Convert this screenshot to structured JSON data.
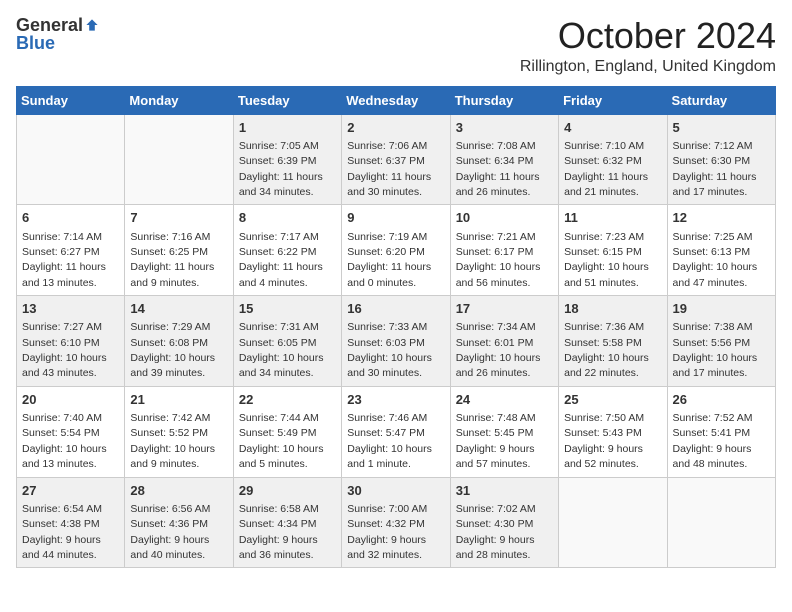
{
  "logo": {
    "general": "General",
    "blue": "Blue"
  },
  "title": "October 2024",
  "location": "Rillington, England, United Kingdom",
  "days_of_week": [
    "Sunday",
    "Monday",
    "Tuesday",
    "Wednesday",
    "Thursday",
    "Friday",
    "Saturday"
  ],
  "weeks": [
    [
      {
        "day": "",
        "info": ""
      },
      {
        "day": "",
        "info": ""
      },
      {
        "day": "1",
        "info": "Sunrise: 7:05 AM\nSunset: 6:39 PM\nDaylight: 11 hours and 34 minutes."
      },
      {
        "day": "2",
        "info": "Sunrise: 7:06 AM\nSunset: 6:37 PM\nDaylight: 11 hours and 30 minutes."
      },
      {
        "day": "3",
        "info": "Sunrise: 7:08 AM\nSunset: 6:34 PM\nDaylight: 11 hours and 26 minutes."
      },
      {
        "day": "4",
        "info": "Sunrise: 7:10 AM\nSunset: 6:32 PM\nDaylight: 11 hours and 21 minutes."
      },
      {
        "day": "5",
        "info": "Sunrise: 7:12 AM\nSunset: 6:30 PM\nDaylight: 11 hours and 17 minutes."
      }
    ],
    [
      {
        "day": "6",
        "info": "Sunrise: 7:14 AM\nSunset: 6:27 PM\nDaylight: 11 hours and 13 minutes."
      },
      {
        "day": "7",
        "info": "Sunrise: 7:16 AM\nSunset: 6:25 PM\nDaylight: 11 hours and 9 minutes."
      },
      {
        "day": "8",
        "info": "Sunrise: 7:17 AM\nSunset: 6:22 PM\nDaylight: 11 hours and 4 minutes."
      },
      {
        "day": "9",
        "info": "Sunrise: 7:19 AM\nSunset: 6:20 PM\nDaylight: 11 hours and 0 minutes."
      },
      {
        "day": "10",
        "info": "Sunrise: 7:21 AM\nSunset: 6:17 PM\nDaylight: 10 hours and 56 minutes."
      },
      {
        "day": "11",
        "info": "Sunrise: 7:23 AM\nSunset: 6:15 PM\nDaylight: 10 hours and 51 minutes."
      },
      {
        "day": "12",
        "info": "Sunrise: 7:25 AM\nSunset: 6:13 PM\nDaylight: 10 hours and 47 minutes."
      }
    ],
    [
      {
        "day": "13",
        "info": "Sunrise: 7:27 AM\nSunset: 6:10 PM\nDaylight: 10 hours and 43 minutes."
      },
      {
        "day": "14",
        "info": "Sunrise: 7:29 AM\nSunset: 6:08 PM\nDaylight: 10 hours and 39 minutes."
      },
      {
        "day": "15",
        "info": "Sunrise: 7:31 AM\nSunset: 6:05 PM\nDaylight: 10 hours and 34 minutes."
      },
      {
        "day": "16",
        "info": "Sunrise: 7:33 AM\nSunset: 6:03 PM\nDaylight: 10 hours and 30 minutes."
      },
      {
        "day": "17",
        "info": "Sunrise: 7:34 AM\nSunset: 6:01 PM\nDaylight: 10 hours and 26 minutes."
      },
      {
        "day": "18",
        "info": "Sunrise: 7:36 AM\nSunset: 5:58 PM\nDaylight: 10 hours and 22 minutes."
      },
      {
        "day": "19",
        "info": "Sunrise: 7:38 AM\nSunset: 5:56 PM\nDaylight: 10 hours and 17 minutes."
      }
    ],
    [
      {
        "day": "20",
        "info": "Sunrise: 7:40 AM\nSunset: 5:54 PM\nDaylight: 10 hours and 13 minutes."
      },
      {
        "day": "21",
        "info": "Sunrise: 7:42 AM\nSunset: 5:52 PM\nDaylight: 10 hours and 9 minutes."
      },
      {
        "day": "22",
        "info": "Sunrise: 7:44 AM\nSunset: 5:49 PM\nDaylight: 10 hours and 5 minutes."
      },
      {
        "day": "23",
        "info": "Sunrise: 7:46 AM\nSunset: 5:47 PM\nDaylight: 10 hours and 1 minute."
      },
      {
        "day": "24",
        "info": "Sunrise: 7:48 AM\nSunset: 5:45 PM\nDaylight: 9 hours and 57 minutes."
      },
      {
        "day": "25",
        "info": "Sunrise: 7:50 AM\nSunset: 5:43 PM\nDaylight: 9 hours and 52 minutes."
      },
      {
        "day": "26",
        "info": "Sunrise: 7:52 AM\nSunset: 5:41 PM\nDaylight: 9 hours and 48 minutes."
      }
    ],
    [
      {
        "day": "27",
        "info": "Sunrise: 6:54 AM\nSunset: 4:38 PM\nDaylight: 9 hours and 44 minutes."
      },
      {
        "day": "28",
        "info": "Sunrise: 6:56 AM\nSunset: 4:36 PM\nDaylight: 9 hours and 40 minutes."
      },
      {
        "day": "29",
        "info": "Sunrise: 6:58 AM\nSunset: 4:34 PM\nDaylight: 9 hours and 36 minutes."
      },
      {
        "day": "30",
        "info": "Sunrise: 7:00 AM\nSunset: 4:32 PM\nDaylight: 9 hours and 32 minutes."
      },
      {
        "day": "31",
        "info": "Sunrise: 7:02 AM\nSunset: 4:30 PM\nDaylight: 9 hours and 28 minutes."
      },
      {
        "day": "",
        "info": ""
      },
      {
        "day": "",
        "info": ""
      }
    ]
  ]
}
